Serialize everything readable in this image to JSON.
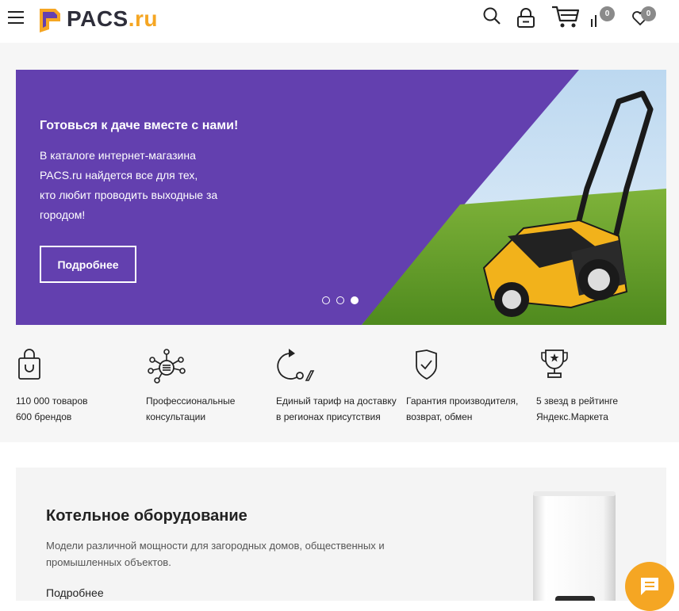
{
  "header": {
    "logo_main": "PACS",
    "logo_tld": ".ru",
    "compare_count": "0",
    "favorites_count": "0"
  },
  "banner": {
    "title": "Готовься к даче вместе с нами!",
    "line1": "В каталоге интернет-магазина",
    "line2": "PACS.ru найдется все для тех,",
    "line3": "кто любит проводить выходные за",
    "line4": "городом!",
    "button_label": "Подробнее",
    "slides_total": 3,
    "active_slide": 3
  },
  "features": [
    {
      "icon": "shopping-bag-icon",
      "line1": "110 000 товаров",
      "line2": "600 брендов"
    },
    {
      "icon": "consultation-network-icon",
      "line1": "Профессиональные",
      "line2": "консультации"
    },
    {
      "icon": "delivery-route-icon",
      "line1": "Единый тариф на доставку",
      "line2": "в регионах присутствия"
    },
    {
      "icon": "shield-check-icon",
      "line1": "Гарантия производителя,",
      "line2": "возврат, обмен"
    },
    {
      "icon": "trophy-star-icon",
      "line1": "5 звезд в рейтинге",
      "line2": "Яндекс.Маркета"
    }
  ],
  "promo_card": {
    "title": "Котельное оборудование",
    "description_line1": "Модели различной мощности для загородных домов, общественных и",
    "description_line2": "промышленных объектов.",
    "link_label": "Подробнее"
  },
  "colors": {
    "banner_bg": "#6340af",
    "accent": "#f5a623",
    "badge": "#8a8a8a"
  }
}
